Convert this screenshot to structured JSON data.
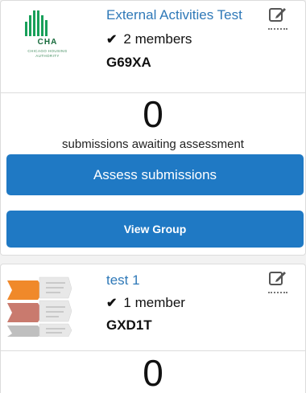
{
  "cards": [
    {
      "title": "External Activities Test",
      "members": "2 members",
      "code": "G69XA",
      "count": "0",
      "count_label": "submissions awaiting assessment",
      "assess_label": "Assess submissions",
      "view_label": "View Group",
      "logo": {
        "wordmark": "CHA",
        "subtitle_line1": "CHICAGO HOUSING",
        "subtitle_line2": "AUTHORITY"
      },
      "icon": "edit-icon",
      "brand_color": "#18a05a"
    },
    {
      "title": "test 1",
      "members": "1 member",
      "code": "GXD1T",
      "count": "0",
      "icon": "edit-icon"
    }
  ],
  "colors": {
    "link": "#2f79b8",
    "button": "#1f79c4",
    "border": "#dcdcdc"
  }
}
